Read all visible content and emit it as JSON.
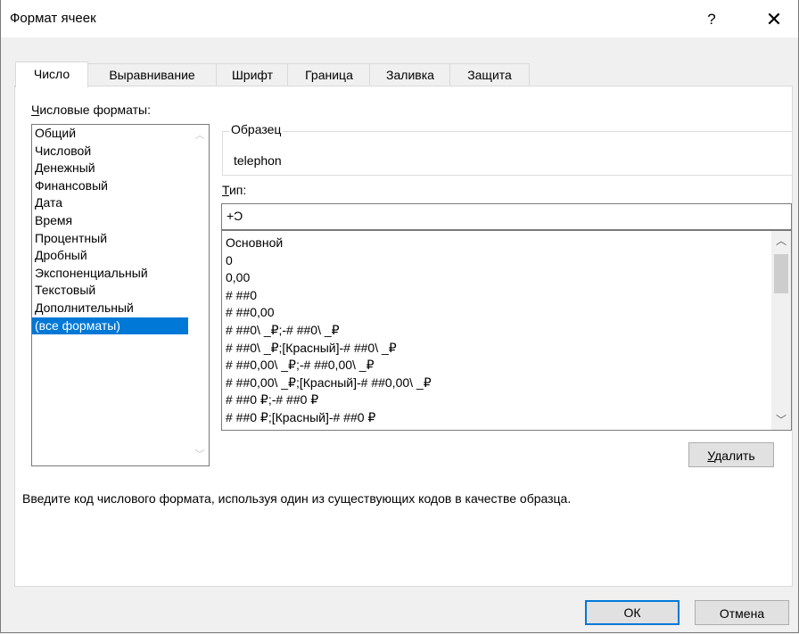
{
  "window": {
    "title": "Формат ячеек",
    "help": "?",
    "close": "✕"
  },
  "tabs": [
    {
      "label": "Число",
      "active": true
    },
    {
      "label": "Выравнивание",
      "active": false
    },
    {
      "label": "Шрифт",
      "active": false
    },
    {
      "label": "Граница",
      "active": false
    },
    {
      "label": "Заливка",
      "active": false
    },
    {
      "label": "Защита",
      "active": false
    }
  ],
  "categories": {
    "label_prefix": "Ч",
    "label_rest": "исловые форматы:",
    "items": [
      "Общий",
      "Числовой",
      "Денежный",
      "Финансовый",
      "Дата",
      "Время",
      "Процентный",
      "Дробный",
      "Экспоненциальный",
      "Текстовый",
      "Дополнительный",
      "(все форматы)"
    ],
    "selected_index": 11
  },
  "sample": {
    "legend": "Образец",
    "value": "telephon"
  },
  "type": {
    "label_prefix": "Т",
    "label_rest": "ип:",
    "value": "+Ͻ"
  },
  "formats": {
    "items": [
      "Основной",
      "0",
      "0,00",
      "# ##0",
      "# ##0,00",
      "# ##0\\ _₽;-# ##0\\ _₽",
      "# ##0\\ _₽;[Красный]-# ##0\\ _₽",
      "# ##0,00\\ _₽;-# ##0,00\\ _₽",
      "# ##0,00\\ _₽;[Красный]-# ##0,00\\ _₽",
      "# ##0 ₽;-# ##0 ₽",
      "# ##0 ₽;[Красный]-# ##0 ₽"
    ]
  },
  "delete_button": {
    "prefix": "У",
    "rest": "далить"
  },
  "hint": "Введите код числового формата, используя один из существующих кодов в качестве образца.",
  "ok_label": "ОК",
  "cancel_label": "Отмена",
  "colors": {
    "accent": "#0078d7",
    "face": "#f0f0f0",
    "button": "#e1e1e1"
  }
}
